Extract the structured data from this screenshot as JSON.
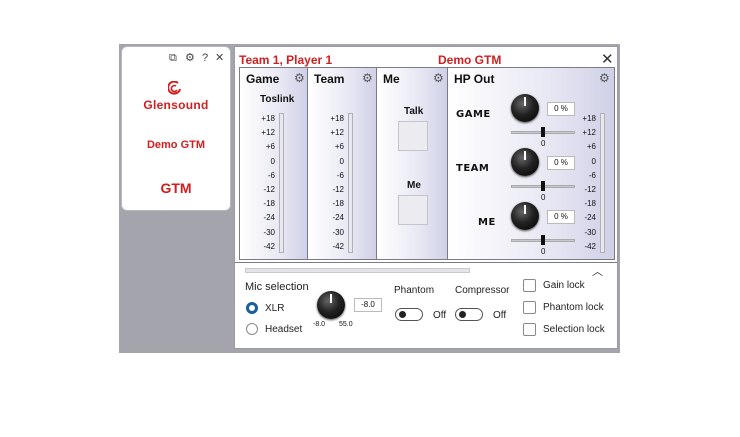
{
  "device_card": {
    "icons": [
      "copy-icon",
      "gear-icon",
      "help-icon",
      "close-icon"
    ],
    "brand": "Glensound",
    "name": "Demo GTM",
    "model": "GTM"
  },
  "panel": {
    "title_left": "Team 1, Player 1",
    "title_center": "Demo GTM",
    "close_glyph": "✕"
  },
  "columns": {
    "game": {
      "title": "Game",
      "sublabel": "Toslink"
    },
    "team": {
      "title": "Team"
    },
    "me": {
      "title": "Me",
      "talk_label": "Talk",
      "me_label": "Me"
    },
    "hp_out": {
      "title": "HP Out"
    }
  },
  "meter_ticks": [
    "+18",
    "+12",
    "+6",
    "0",
    "-6",
    "-12",
    "-18",
    "-24",
    "-30",
    "-42"
  ],
  "hp_channels": [
    {
      "label": "GAME",
      "value": "0 %",
      "zero": "0"
    },
    {
      "label": "TEAM",
      "value": "0 %",
      "zero": "0"
    },
    {
      "label": "ME",
      "value": "0 %",
      "zero": "0"
    }
  ],
  "bottom": {
    "mic_selection_label": "Mic selection",
    "xlr_label": "XLR",
    "headset_label": "Headset",
    "selected": "XLR",
    "gain_value": "-8.0",
    "gain_min": "-8.0",
    "gain_max": "55.0",
    "phantom_label": "Phantom",
    "phantom_state": "Off",
    "compressor_label": "Compressor",
    "compressor_state": "Off",
    "gain_lock_label": "Gain lock",
    "phantom_lock_label": "Phantom lock",
    "selection_lock_label": "Selection lock"
  },
  "colors": {
    "brand_red": "#d21e1e",
    "accent_blue": "#1a5fa0"
  }
}
